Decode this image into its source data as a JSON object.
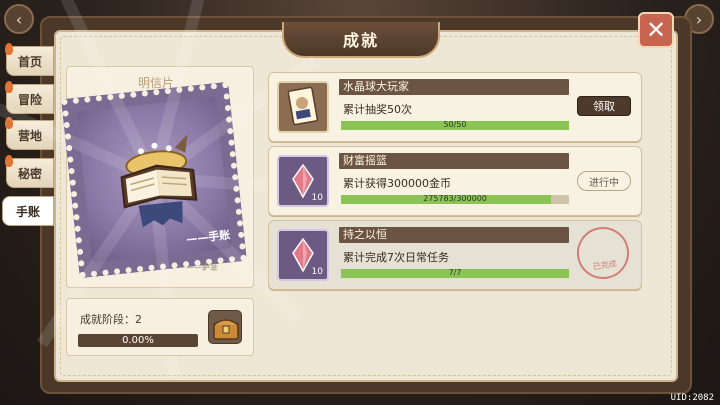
{
  "title": "成就",
  "close_icon_glyph": "✕",
  "sidebar": {
    "items": [
      {
        "label": "首页"
      },
      {
        "label": "冒险"
      },
      {
        "label": "营地"
      },
      {
        "label": "秘密"
      },
      {
        "label": "手账"
      }
    ],
    "active_index": 4
  },
  "postcard": {
    "title": "明信片",
    "stamp_label": "——手账",
    "signature": "——萨菲"
  },
  "stage": {
    "label": "成就阶段：2",
    "progress_text": "0.00%",
    "progress": 0.0
  },
  "achievements": [
    {
      "name": "水晶球大玩家",
      "desc": "累计抽奖50次",
      "progress_text": "50/50",
      "progress": 1.0,
      "icon": "card-icon",
      "count": "",
      "button": "领取"
    },
    {
      "name": "财富摇篮",
      "desc": "累计获得300000金币",
      "progress_text": "275783/300000",
      "progress": 0.919,
      "icon": "crystal-icon",
      "count": "10",
      "button": "进行中"
    },
    {
      "name": "持之以恒",
      "desc": "累计完成7次日常任务",
      "progress_text": "7/7",
      "progress": 1.0,
      "icon": "crystal-icon",
      "count": "10",
      "stamp": "已完成"
    }
  ],
  "uid": "UID:2082",
  "colors": {
    "accent_green": "#8ac454",
    "tab_brown": "#6b5441",
    "close_red": "#c86551"
  }
}
